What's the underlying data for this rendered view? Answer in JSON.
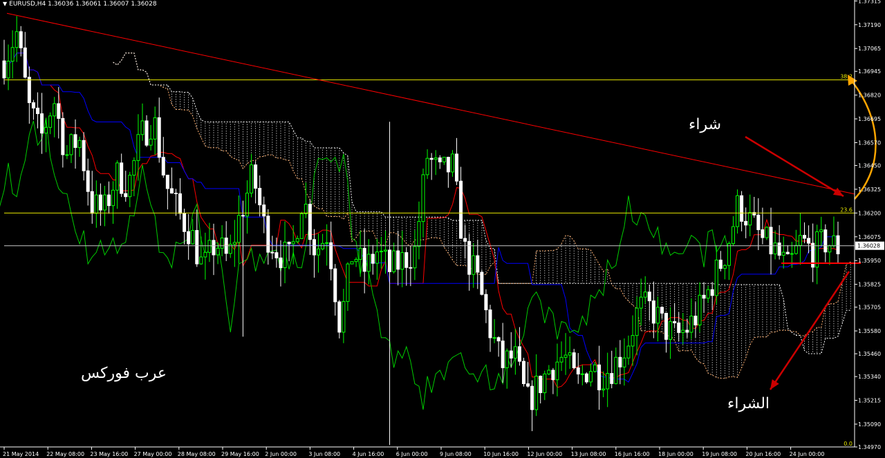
{
  "header": {
    "symbol": "EURUSD,H4",
    "ohlc": "1.36036 1.36061 1.36007 1.36028"
  },
  "annotations": {
    "buy": "شراء",
    "buy_def": "الشراء",
    "brand": "عرب فوركس"
  },
  "colors": {
    "background": "#000000",
    "bull": "#00ff00",
    "bear": "#ffffff",
    "tenkan": "#ff0000",
    "kijun": "#0000ff",
    "chikou": "#00cc00",
    "cloud": "#ffffff",
    "fib": "#e8e800",
    "trendline": "#ff0000",
    "arrow_red": "#cc0000",
    "arrow_orange": "#ffa500"
  },
  "chart_data": {
    "type": "candlestick",
    "symbol": "EURUSD",
    "timeframe": "H4",
    "indicators": [
      "Ichimoku Kinko Hyo"
    ],
    "ylim": [
      1.3497,
      1.3732
    ],
    "last_price": "1.36028",
    "y_ticks": [
      "1.37315",
      "1.37190",
      "1.37065",
      "1.36945",
      "1.36820",
      "1.36695",
      "1.36570",
      "1.36450",
      "1.36325",
      "1.36200",
      "1.36075",
      "1.35950",
      "1.35825",
      "1.35705",
      "1.35580",
      "1.35460",
      "1.35340",
      "1.35215",
      "1.35090",
      "1.34970"
    ],
    "x_ticks": [
      "21 May 2014",
      "22 May 08:00",
      "23 May 16:00",
      "27 May 00:00",
      "28 May 08:00",
      "29 May 16:00",
      "2 Jun 00:00",
      "3 Jun 08:00",
      "4 Jun 16:00",
      "6 Jun 00:00",
      "9 Jun 08:00",
      "10 Jun 16:00",
      "12 Jun 00:00",
      "13 Jun 08:00",
      "16 Jun 16:00",
      "18 Jun 00:00",
      "19 Jun 08:00",
      "20 Jun 16:00",
      "24 Jun 00:00"
    ],
    "fibonacci": [
      {
        "label": "38.2",
        "price": 1.369
      },
      {
        "label": "23.6",
        "price": 1.362
      },
      {
        "label": "0.0",
        "price": 1.3497
      }
    ],
    "horizontal_lines": [
      {
        "price": 1.36028
      }
    ],
    "trendline": {
      "from": [
        0,
        1.3725
      ],
      "to": [
        1,
        1.363
      ]
    },
    "close_path": [
      1.37,
      1.3715,
      1.3675,
      1.366,
      1.368,
      1.365,
      1.366,
      1.3625,
      1.362,
      1.364,
      1.3635,
      1.366,
      1.367,
      1.3635,
      1.362,
      1.361,
      1.359,
      1.3605,
      1.3595,
      1.362,
      1.364,
      1.361,
      1.36,
      1.3595,
      1.363,
      1.36,
      1.361,
      1.356,
      1.36,
      1.359,
      1.36,
      1.359,
      1.3595,
      1.36,
      1.365,
      1.364,
      1.3645,
      1.36,
      1.3585,
      1.356,
      1.354,
      1.3545,
      1.352,
      1.353,
      1.354,
      1.3545,
      1.353,
      1.354,
      1.3535,
      1.354,
      1.355,
      1.357,
      1.357,
      1.356,
      1.3555,
      1.356,
      1.357,
      1.3585,
      1.36,
      1.3625,
      1.3615,
      1.3605,
      1.36,
      1.359,
      1.3605,
      1.36,
      1.3605,
      1.3602
    ]
  }
}
